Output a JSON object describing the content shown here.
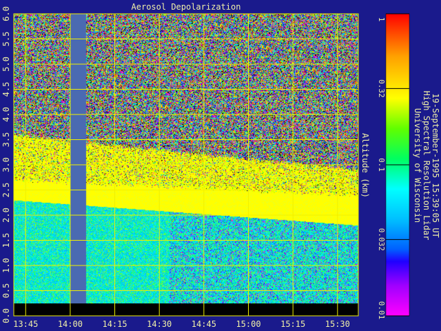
{
  "chart_data": {
    "type": "heatmap",
    "title": "Aerosol Depolarization",
    "ylabel": "Altitude (km)",
    "xlabel": "",
    "x_ticks": [
      "13:45",
      "14:00",
      "14:15",
      "14:30",
      "14:45",
      "15:00",
      "15:15",
      "15:30"
    ],
    "y_ticks": [
      "0.0",
      "0.5",
      "1.0",
      "1.5",
      "2.0",
      "2.5",
      "3.0",
      "3.5",
      "4.0",
      "4.5",
      "5.0",
      "5.5",
      "6.0"
    ],
    "x_range_minutes": [
      13.7,
      15.62
    ],
    "y_range_km": [
      0,
      6.0
    ],
    "grid": true,
    "colorbar": {
      "scale": "log",
      "ticks": [
        "1",
        "0.32",
        "0.1",
        "0.032",
        "0.01"
      ],
      "range": [
        0.01,
        1
      ]
    },
    "caption_lines": [
      "University of Wisconsin",
      "High Spectral Resolution Lidar",
      "19-September-1995 15:39:05 UT"
    ],
    "data_gap": {
      "start_time": "14:00",
      "end_time": "14:03"
    },
    "cloud_layer_km": {
      "top_start": 2.7,
      "top_end": 2.4,
      "base_start": 2.3,
      "base_end": 1.8
    },
    "colors": {
      "background": "#1a1a8c",
      "grid": "#f0f000",
      "text": "#f0f0a8",
      "gap": "#4a6ab2"
    }
  }
}
